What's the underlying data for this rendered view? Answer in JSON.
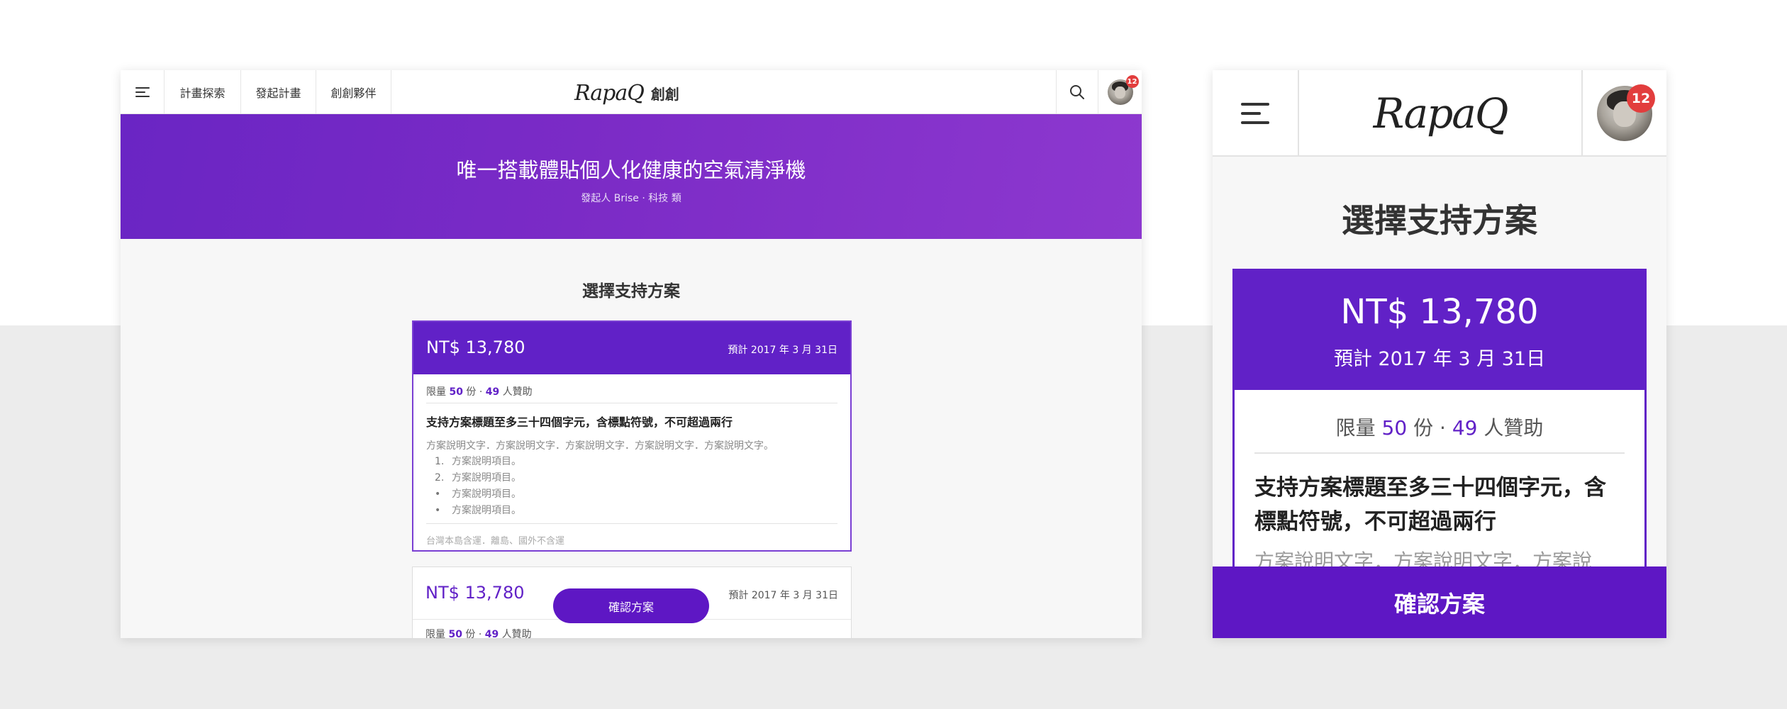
{
  "colors": {
    "brand_purple": "#6121c7",
    "badge_red": "#e23d3d",
    "hero_gradient_start": "#6a25c4",
    "hero_gradient_end": "#8d38cf"
  },
  "desktop": {
    "nav": {
      "menu_icon": "hamburger-icon",
      "items": [
        {
          "label": "計畫探索"
        },
        {
          "label": "發起計畫"
        },
        {
          "label": "創創夥伴"
        }
      ],
      "logo_script": "RapaQ",
      "logo_cn": "創創",
      "search_icon": "search-icon",
      "notification_count": "12"
    },
    "hero": {
      "title": "唯一搭載體貼個人化健康的空氣清淨機",
      "subtitle": "發起人 Brise · 科技 類"
    },
    "section_title": "選擇支持方案",
    "plans": [
      {
        "price": "NT$ 13,780",
        "date": "預計 2017 年 3 月 31日",
        "limit_prefix": "限量",
        "limit_count": "50",
        "limit_mid": "份 ·",
        "backers": "49",
        "backers_suffix": "人贊助",
        "title": "支持方案標題至多三十四個字元，含標點符號，不可超過兩行",
        "description": "方案說明文字．方案說明文字．方案說明文字．方案說明文字．方案說明文字。",
        "items": [
          {
            "marker": "1.",
            "text": "方案說明項目。"
          },
          {
            "marker": "2.",
            "text": "方案說明項目。"
          },
          {
            "marker": "•",
            "text": "方案說明項目。"
          },
          {
            "marker": "•",
            "text": "方案說明項目。"
          }
        ],
        "shipping": "台灣本島含運．離島、國外不含運"
      },
      {
        "price": "NT$ 13,780",
        "date": "預計 2017 年 3 月 31日",
        "limit_prefix": "限量",
        "limit_count": "50",
        "limit_mid": "份 ·",
        "backers": "49",
        "backers_suffix": "人贊助"
      }
    ],
    "confirm_label": "確認方案"
  },
  "mobile": {
    "nav": {
      "menu_icon": "hamburger-icon",
      "logo_script": "RapaQ",
      "notification_count": "12"
    },
    "section_title": "選擇支持方案",
    "plan": {
      "price": "NT$ 13,780",
      "date": "預計 2017 年 3 月 31日",
      "limit_prefix": "限量",
      "limit_count": "50",
      "limit_mid": "份 ·",
      "backers": "49",
      "backers_suffix": "人贊助",
      "title": "支持方案標題至多三十四個字元，含標點符號，不可超過兩行",
      "description": "方案說明文字．方案說明文字．方案說"
    },
    "confirm_label": "確認方案"
  }
}
